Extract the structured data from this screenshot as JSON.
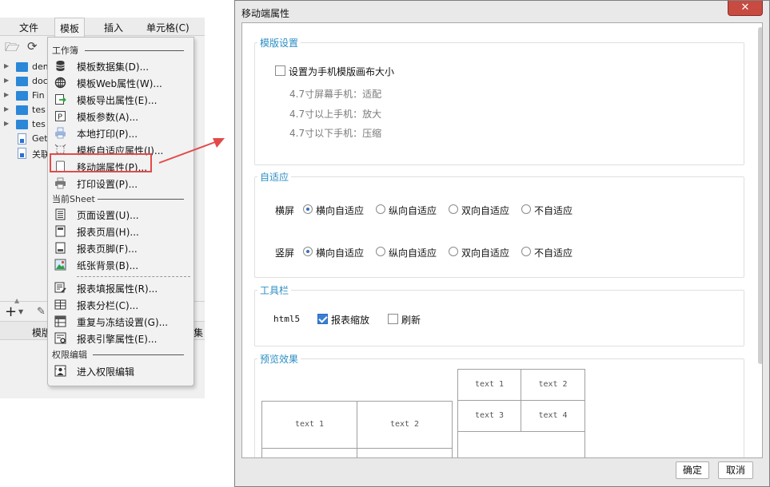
{
  "menubar": {
    "items": [
      "文件",
      "模板",
      "插入",
      "单元格(C)"
    ],
    "active": "模板"
  },
  "tree": {
    "items": [
      {
        "label": "dem",
        "type": "folder"
      },
      {
        "label": "doc",
        "type": "folder"
      },
      {
        "label": "Fin",
        "type": "folder"
      },
      {
        "label": "tes",
        "type": "folder"
      },
      {
        "label": "tes",
        "type": "folder"
      },
      {
        "label": "Get",
        "type": "file"
      },
      {
        "label": "关联",
        "type": "file"
      }
    ]
  },
  "bottom": {
    "add_label": "+",
    "tab_left": "模版",
    "tab_right": "集"
  },
  "dropdown": {
    "workbook_header": "工作簿",
    "workbook_items": [
      {
        "label": "模板数据集(D)...",
        "icon": "database-icon"
      },
      {
        "label": "模板Web属性(W)...",
        "icon": "globe-icon"
      },
      {
        "label": "模板导出属性(E)...",
        "icon": "export-icon"
      },
      {
        "label": "模板参数(A)...",
        "icon": "parameter-icon"
      },
      {
        "label": "本地打印(P)...",
        "icon": "printer-icon"
      },
      {
        "label": "模板自适应属性(I)...",
        "icon": "adaptive-icon"
      },
      {
        "label": "移动端属性(P)...",
        "icon": "mobile-icon"
      },
      {
        "label": "打印设置(P)...",
        "icon": "print-settings-icon"
      }
    ],
    "sheet_header": "当前Sheet",
    "sheet_items": [
      {
        "label": "页面设置(U)...",
        "icon": "page-setup-icon"
      },
      {
        "label": "报表页眉(H)...",
        "icon": "header-icon"
      },
      {
        "label": "报表页脚(F)...",
        "icon": "footer-icon"
      },
      {
        "label": "纸张背景(B)...",
        "icon": "background-image-icon"
      },
      {
        "label": "报表填报属性(R)...",
        "icon": "fill-properties-icon"
      },
      {
        "label": "报表分栏(C)...",
        "icon": "columns-icon"
      },
      {
        "label": "重复与冻结设置(G)...",
        "icon": "freeze-icon"
      },
      {
        "label": "报表引擎属性(E)...",
        "icon": "engine-icon"
      }
    ],
    "permission_header": "权限编辑",
    "permission_items": [
      {
        "label": "进入权限编辑",
        "icon": "permission-icon"
      }
    ],
    "highlight_color": "#e24a4a"
  },
  "dialog": {
    "title": "移动端属性",
    "close_label": "✕",
    "template_settings": {
      "title": "模版设置",
      "canvas_checkbox": {
        "label": "设置为手机模版画布大小",
        "checked": false
      },
      "notes": [
        "4.7寸屏幕手机：适配",
        "4.7寸以上手机：放大",
        "4.7寸以下手机：压缩"
      ]
    },
    "adaptive": {
      "title": "自适应",
      "rows": [
        {
          "label": "横屏",
          "options": [
            "横向自适应",
            "纵向自适应",
            "双向自适应",
            "不自适应"
          ],
          "selected": 0
        },
        {
          "label": "竖屏",
          "options": [
            "横向自适应",
            "纵向自适应",
            "双向自适应",
            "不自适应"
          ],
          "selected": 0
        }
      ]
    },
    "toolbar": {
      "title": "工具栏",
      "label": "html5",
      "zoom": {
        "label": "报表缩放",
        "checked": true
      },
      "refresh": {
        "label": "刷新",
        "checked": false
      }
    },
    "preview": {
      "title": "预览效果",
      "landscape_cells": [
        "text 1",
        "text 2"
      ],
      "portrait_cells": [
        "text 1",
        "text 2",
        "text 3",
        "text 4"
      ]
    },
    "ok_label": "确定",
    "cancel_label": "取消"
  },
  "colors": {
    "accent_blue": "#2b8ec4",
    "close_red": "#c74b41",
    "arrow_red": "#e24a4a"
  }
}
